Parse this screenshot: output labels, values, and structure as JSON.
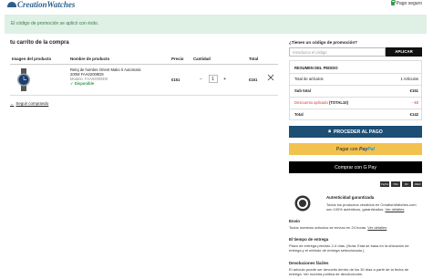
{
  "header": {
    "brand": "CreationWatches",
    "secure_label": "Pago seguro"
  },
  "alert": {
    "message": "El código de promoción se aplicó con éxito."
  },
  "cart": {
    "title": "tu carrito de la compra",
    "columns": [
      "Imagen del producto",
      "Nombre de producto",
      "Precio",
      "Cantidad",
      "Total"
    ],
    "items": [
      {
        "name_line1": "Reloj de hombre Orient Mako II Automatic",
        "name_line2": "200M FAA02009D9",
        "model": "Modelo: FAA02009D9",
        "stock": "Disponible",
        "price": "€151",
        "qty": "1",
        "total": "€151"
      }
    ],
    "back_link": "Seguir comprando"
  },
  "promo": {
    "question": "¿Tienes un código de promoción?",
    "placeholder": "Introduzca el código",
    "apply_label": "APLICAR"
  },
  "summary": {
    "title": "RESUMEN DEL PEDIDO",
    "items_label": "Total de artículos",
    "items_value": "1 Artículos",
    "subtotal_label": "Sub total",
    "subtotal_value": "€151",
    "discount_label": "Descuento aplicado",
    "discount_code": "(TOTAL10)",
    "discount_value": "- €8",
    "total_label": "Total",
    "total_value": "€142"
  },
  "payment": {
    "proceed_label": "PROCEDER AL PAGO",
    "paypal_prefix": "Pagar con",
    "paypal_brand_a": "Pay",
    "paypal_brand_b": "Pal",
    "gpay_prefix": "Comprar con",
    "gpay_brand": "G Pay",
    "cards": [
      "PayPal",
      "VISA",
      "MC",
      "AMEX"
    ]
  },
  "guarantee": {
    "title": "Autenticidad garantizada",
    "text": "Todos los productos vendidos en CreationWatches.com son 100% auténticos, garantizados.",
    "details_link": "Ver detalles"
  },
  "shipping": {
    "envio_title": "Envío",
    "envio_text": "Todos nuestros artículos se envían en 24 horas.",
    "envio_link": "Ver detalles",
    "delivery_title": "El tiempo de entrega",
    "delivery_text": "Plazo de entrega previsto 2-4 días. (Nota: Está se basa en la ubicación de entrega y el método de entrega seleccionado.)",
    "returns_title": "Devoluciones fáciles",
    "returns_text": "El artículo puede ser devuelto dentro de los 30 días a partir de la fecha de entrega. Ver nuestra política de devoluciones."
  },
  "colors": {
    "brand": "#2a5f8a",
    "success": "#2e9b4b",
    "proceed": "#1d4e74",
    "paypal": "#f2c14e",
    "discount": "#d43a3a"
  }
}
